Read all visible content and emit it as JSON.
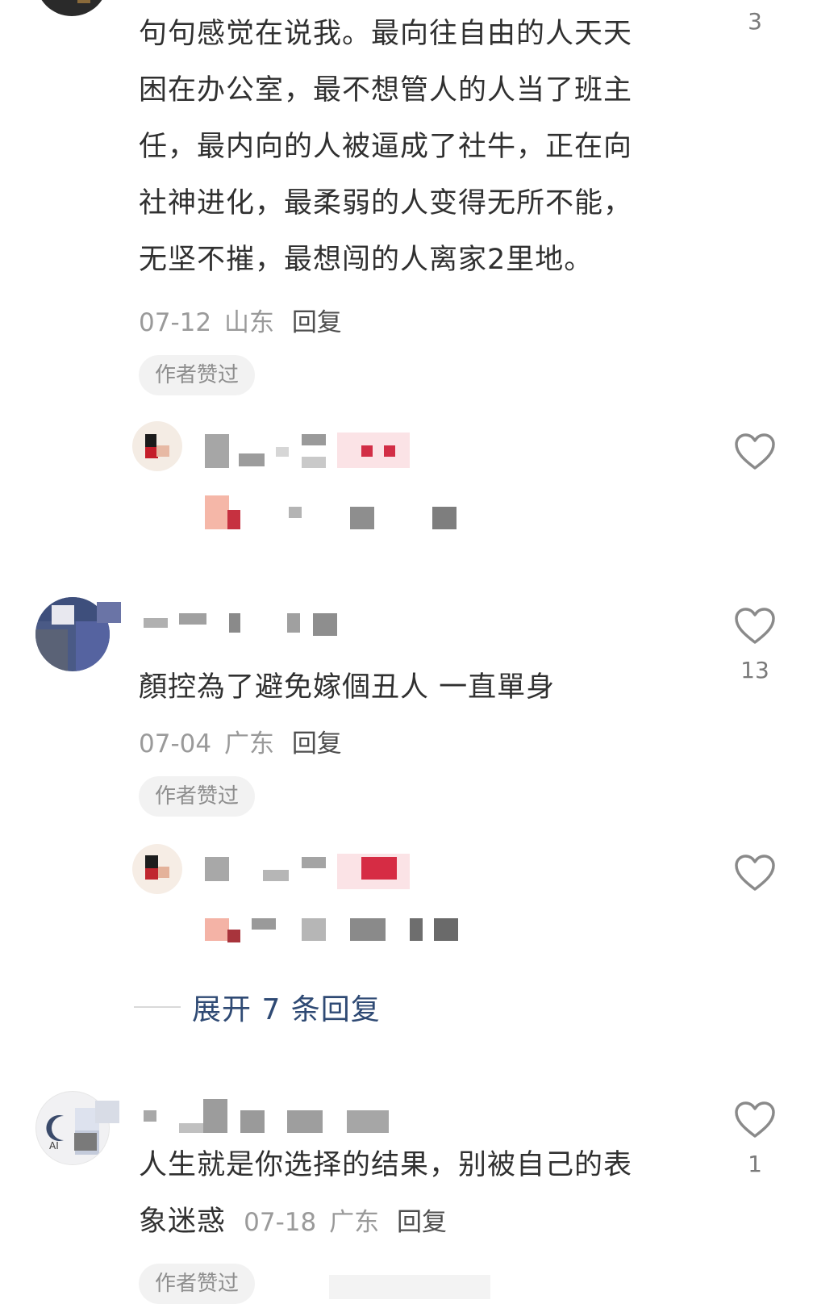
{
  "comments": [
    {
      "lines": [
        "句句感觉在说我。最向往自由的人天天",
        "困在办公室，最不想管人的人当了班主",
        "任，最内向的人被逼成了社牛，正在向",
        "社神进化，最柔弱的人变得无所不能，",
        "无坚不摧，最想闯的人离家2里地。"
      ],
      "date": "07-12",
      "location": "山东",
      "reply_label": "回复",
      "badge": "作者赞过",
      "like_count": "3"
    },
    {
      "text": "顏控為了避免嫁個丑人 一直單身",
      "date": "07-04",
      "location": "广东",
      "reply_label": "回复",
      "badge": "作者赞过",
      "like_count": "13"
    },
    {
      "lines": [
        "人生就是你选择的结果，别被自己的表",
        "象迷惑"
      ],
      "date": "07-18",
      "location": "广东",
      "reply_label": "回复",
      "badge": "作者赞过",
      "like_count": "1"
    }
  ],
  "expand_replies": {
    "label": "展开 7 条回复"
  },
  "avatar_labels": {
    "third": "AI"
  },
  "colors": {
    "text": "#303030",
    "meta": "#9a9a9a",
    "expand": "#2f4a74",
    "heart": "#8a8a8a",
    "badge_bg": "#f2f2f2"
  }
}
